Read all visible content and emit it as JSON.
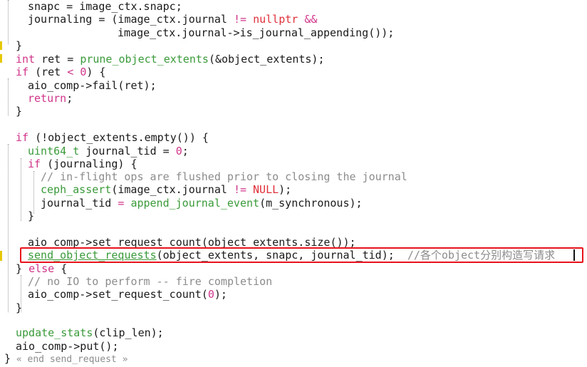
{
  "code": {
    "lines": [
      {
        "tokens": [
          {
            "t": "snapc = image_ctx.snapc;",
            "c": "def"
          }
        ]
      },
      {
        "tokens": [
          {
            "t": "journaling = (image_ctx.journal ",
            "c": "def"
          },
          {
            "t": "!=",
            "c": "op"
          },
          {
            "t": " ",
            "c": "def"
          },
          {
            "t": "nullptr",
            "c": "lit"
          },
          {
            "t": " ",
            "c": "def"
          },
          {
            "t": "&&",
            "c": "op"
          }
        ]
      },
      {
        "tokens": [
          {
            "t": "image_ctx.journal->is_journal_appending());",
            "c": "def"
          }
        ]
      },
      {
        "tokens": [
          {
            "t": "}",
            "c": "def"
          }
        ]
      },
      {
        "tokens": [
          {
            "t": "int",
            "c": "kw"
          },
          {
            "t": " ret = ",
            "c": "def"
          },
          {
            "t": "prune_object_extents",
            "c": "fn"
          },
          {
            "t": "(&object_extents);",
            "c": "def"
          }
        ]
      },
      {
        "tokens": [
          {
            "t": "if",
            "c": "kw"
          },
          {
            "t": " (ret ",
            "c": "def"
          },
          {
            "t": "<",
            "c": "op"
          },
          {
            "t": " ",
            "c": "def"
          },
          {
            "t": "0",
            "c": "num"
          },
          {
            "t": ") {",
            "c": "def"
          }
        ]
      },
      {
        "tokens": [
          {
            "t": "aio_comp->fail(ret);",
            "c": "def"
          }
        ]
      },
      {
        "tokens": [
          {
            "t": "return",
            "c": "kw"
          },
          {
            "t": ";",
            "c": "def"
          }
        ]
      },
      {
        "tokens": [
          {
            "t": "}",
            "c": "def"
          }
        ]
      },
      {
        "tokens": []
      },
      {
        "tokens": [
          {
            "t": "if",
            "c": "kw"
          },
          {
            "t": " (!object_extents.empty()) {",
            "c": "def"
          }
        ]
      },
      {
        "tokens": [
          {
            "t": "uint64_t",
            "c": "type"
          },
          {
            "t": " journal_tid = ",
            "c": "def"
          },
          {
            "t": "0",
            "c": "num"
          },
          {
            "t": ";",
            "c": "def"
          }
        ]
      },
      {
        "tokens": [
          {
            "t": "if",
            "c": "kw"
          },
          {
            "t": " (journaling) {",
            "c": "def"
          }
        ]
      },
      {
        "tokens": [
          {
            "t": "// in-flight ops are flushed prior to closing the journal",
            "c": "cm"
          }
        ]
      },
      {
        "tokens": [
          {
            "t": "ceph_assert",
            "c": "fn"
          },
          {
            "t": "(image_ctx.journal ",
            "c": "def"
          },
          {
            "t": "!=",
            "c": "op"
          },
          {
            "t": " ",
            "c": "def"
          },
          {
            "t": "NULL",
            "c": "lit"
          },
          {
            "t": ");",
            "c": "def"
          }
        ]
      },
      {
        "tokens": [
          {
            "t": "journal_tid ",
            "c": "def"
          },
          {
            "t": "=",
            "c": "op"
          },
          {
            "t": " ",
            "c": "def"
          },
          {
            "t": "append_journal_event",
            "c": "fn"
          },
          {
            "t": "(m_synchronous);",
            "c": "def"
          }
        ]
      },
      {
        "tokens": [
          {
            "t": "}",
            "c": "def"
          }
        ]
      },
      {
        "tokens": []
      },
      {
        "tokens": [
          {
            "t": "aio_comp->set_request_count(object_extents.size());",
            "c": "def"
          }
        ]
      },
      {
        "tokens": [
          {
            "t": "send_object_requests",
            "c": "fn"
          },
          {
            "t": "(object_extents, snapc, journal_tid);  ",
            "c": "def"
          },
          {
            "t": "//各个object分别构造写请求",
            "c": "cm"
          }
        ]
      },
      {
        "tokens": [
          {
            "t": "} ",
            "c": "def"
          },
          {
            "t": "else",
            "c": "kw"
          },
          {
            "t": " {",
            "c": "def"
          }
        ]
      },
      {
        "tokens": [
          {
            "t": "// no IO to perform -- fire completion",
            "c": "cm"
          }
        ]
      },
      {
        "tokens": [
          {
            "t": "aio_comp->set_request_count(",
            "c": "def"
          },
          {
            "t": "0",
            "c": "num"
          },
          {
            "t": ");",
            "c": "def"
          }
        ]
      },
      {
        "tokens": [
          {
            "t": "}",
            "c": "def"
          }
        ]
      },
      {
        "tokens": []
      },
      {
        "tokens": [
          {
            "t": "update_stats",
            "c": "fn"
          },
          {
            "t": "(clip_len);",
            "c": "def"
          }
        ]
      },
      {
        "tokens": [
          {
            "t": "aio_comp->put();",
            "c": "def"
          }
        ]
      },
      {
        "tokens": [
          {
            "t": "}",
            "c": "def"
          },
          {
            "t": " « end send_request »",
            "c": "fold"
          }
        ]
      }
    ]
  }
}
